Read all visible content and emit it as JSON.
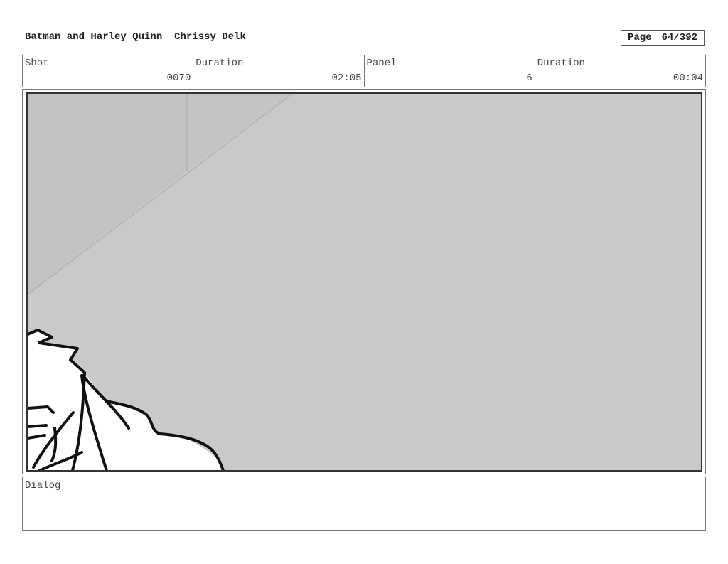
{
  "header": {
    "title": "Batman and Harley Quinn",
    "artist": "Chrissy Delk",
    "page_label": "Page",
    "page_value": "64/392"
  },
  "meta": {
    "shot_label": "Shot",
    "shot_value": "0070",
    "shot_duration_label": "Duration",
    "shot_duration_value": "02:05",
    "panel_label": "Panel",
    "panel_value": "6",
    "panel_duration_label": "Duration",
    "panel_duration_value": "00:04"
  },
  "dialog": {
    "label": "Dialog",
    "text": ""
  },
  "colors": {
    "panel_background": "#c9c9c9",
    "wall_shade": "#c2c2c2",
    "ink": "#111111"
  }
}
